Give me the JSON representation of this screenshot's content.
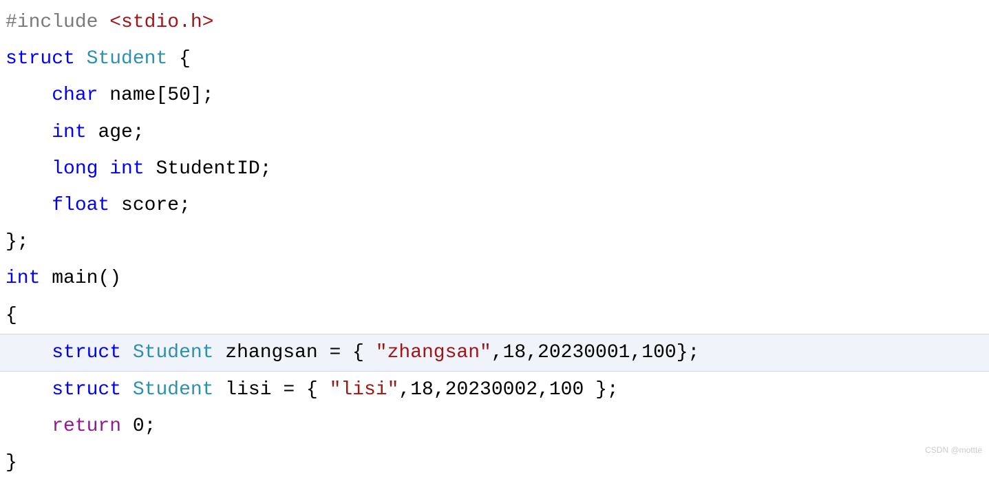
{
  "code": {
    "line1": {
      "include": "#include",
      "space": " ",
      "path": "<stdio.h>"
    },
    "line2": {
      "struct": "struct",
      "space": " ",
      "typename": "Student",
      "space2": " ",
      "brace": "{"
    },
    "line3": {
      "indent": "    ",
      "type": "char",
      "space": " ",
      "name": "name",
      "bracket": "[",
      "size": "50",
      "close": "];"
    },
    "line4": {
      "indent": "    ",
      "type": "int",
      "space": " ",
      "name": "age",
      "semi": ";"
    },
    "line5": {
      "indent": "    ",
      "type1": "long",
      "space": " ",
      "type2": "int",
      "space2": " ",
      "name": "StudentID",
      "semi": ";"
    },
    "line6": {
      "indent": "    ",
      "type": "float",
      "space": " ",
      "name": "score",
      "semi": ";"
    },
    "line7": {
      "close": "};"
    },
    "line8": {
      "type": "int",
      "space": " ",
      "name": "main",
      "parens": "()"
    },
    "line9": {
      "brace": "{"
    },
    "line10": {
      "indent": "    ",
      "struct": "struct",
      "space": " ",
      "typename": "Student",
      "space2": " ",
      "varname": "zhangsan",
      "space3": " ",
      "eq": "=",
      "space4": " ",
      "brace": "{",
      "space5": " ",
      "str": "\"zhangsan\"",
      "comma1": ",",
      "val1": "18",
      "comma2": ",",
      "val2": "20230001",
      "comma3": ",",
      "val3": "100",
      "close": "};"
    },
    "line11": {
      "indent": "    ",
      "struct": "struct",
      "space": " ",
      "typename": "Student",
      "space2": " ",
      "varname": "lisi",
      "space3": " ",
      "eq": "=",
      "space4": " ",
      "brace": "{",
      "space5": " ",
      "str": "\"lisi\"",
      "comma1": ",",
      "val1": "18",
      "comma2": ",",
      "val2": "20230002",
      "comma3": ",",
      "val3": "100",
      "space6": " ",
      "close": "};"
    },
    "line12": {
      "indent": "    ",
      "return": "return",
      "space": " ",
      "val": "0",
      "semi": ";"
    },
    "line13": {
      "brace": "}"
    }
  },
  "watermark": "CSDN @mottte"
}
